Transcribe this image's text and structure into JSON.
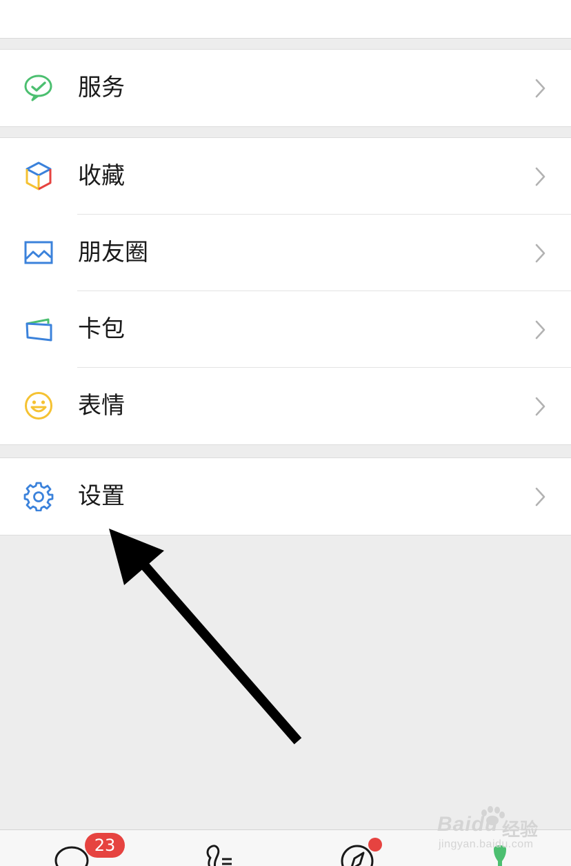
{
  "menu": {
    "services": {
      "label": "服务",
      "icon": "wechat-pay-icon",
      "color": "#4cbf70"
    },
    "favorites": {
      "label": "收藏",
      "icon": "cube-icon"
    },
    "moments": {
      "label": "朋友圈",
      "icon": "picture-icon",
      "color": "#3b82db"
    },
    "cards": {
      "label": "卡包",
      "icon": "wallet-icon",
      "color": "#3b82db"
    },
    "stickers": {
      "label": "表情",
      "icon": "smiley-icon",
      "color": "#f5c232"
    },
    "settings": {
      "label": "设置",
      "icon": "gear-icon",
      "color": "#3b82db"
    }
  },
  "tabbar": {
    "chats_badge": "23",
    "tabs": [
      "chat-bubble-icon",
      "contacts-icon",
      "compass-icon",
      "me-icon"
    ]
  },
  "watermark": {
    "brand": "Baidu",
    "cn": "经验",
    "url": "jingyan.baidu.com"
  }
}
